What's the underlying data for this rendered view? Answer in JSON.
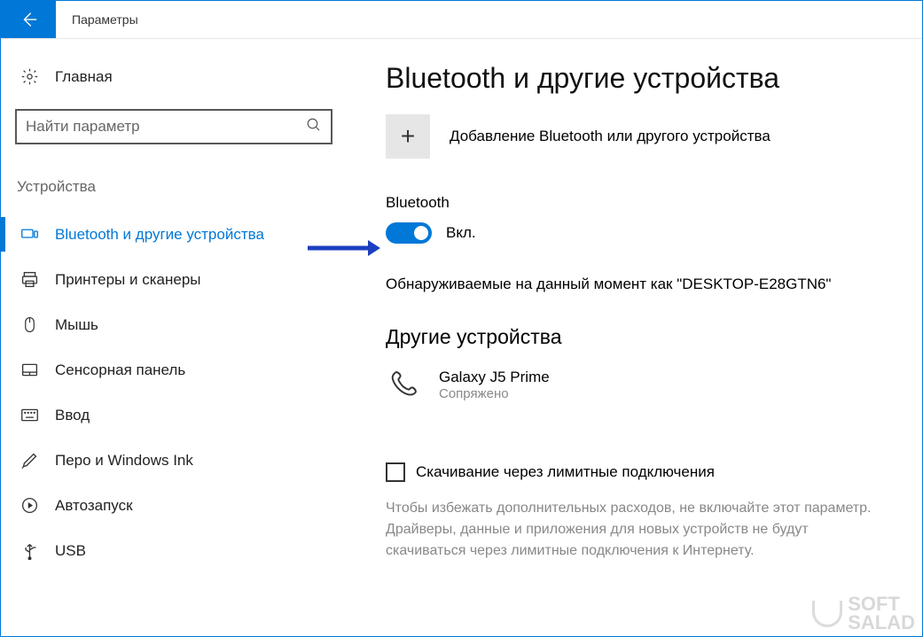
{
  "titlebar": {
    "title": "Параметры"
  },
  "sidebar": {
    "home": "Главная",
    "search_placeholder": "Найти параметр",
    "category": "Устройства",
    "items": [
      {
        "label": "Bluetooth и другие устройства",
        "icon": "devices-icon",
        "active": true
      },
      {
        "label": "Принтеры и сканеры",
        "icon": "printer-icon",
        "active": false
      },
      {
        "label": "Мышь",
        "icon": "mouse-icon",
        "active": false
      },
      {
        "label": "Сенсорная панель",
        "icon": "touchpad-icon",
        "active": false
      },
      {
        "label": "Ввод",
        "icon": "keyboard-icon",
        "active": false
      },
      {
        "label": "Перо и Windows Ink",
        "icon": "pen-icon",
        "active": false
      },
      {
        "label": "Автозапуск",
        "icon": "autoplay-icon",
        "active": false
      },
      {
        "label": "USB",
        "icon": "usb-icon",
        "active": false
      }
    ]
  },
  "main": {
    "title": "Bluetooth и другие устройства",
    "add_device_label": "Добавление Bluetooth или другого устройства",
    "bluetooth_label": "Bluetooth",
    "toggle_state": "Вкл.",
    "discoverable": "Обнаруживаемые на данный момент как \"DESKTOP-E28GTN6\"",
    "other_devices_header": "Другие устройства",
    "devices": [
      {
        "name": "Galaxy J5 Prime",
        "status": "Сопряжено",
        "icon": "phone-icon"
      }
    ],
    "metered": {
      "checkbox_label": "Скачивание через лимитные подключения",
      "description": "Чтобы избежать дополнительных расходов, не включайте этот параметр. Драйверы, данные и приложения для новых устройств не будут скачиваться через лимитные подключения к Интернету."
    }
  },
  "watermark": {
    "line1": "SOFT",
    "line2": "SALAD"
  }
}
